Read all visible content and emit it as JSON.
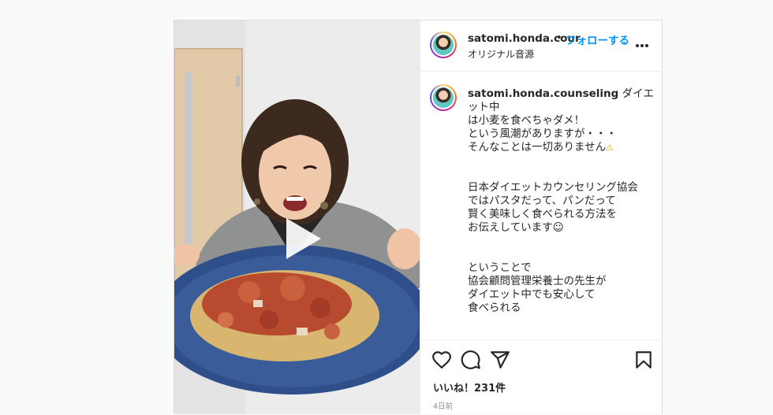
{
  "header": {
    "username": "satomi.honda.cour",
    "dot": "•",
    "follow_label": "フォローする",
    "audio_label": "オリジナル音源",
    "more_icon": "more-horizontal-icon"
  },
  "caption": {
    "username": "satomi.honda.counseling",
    "first_line": " ダイエット中",
    "lines1": [
      "は小麦を食べちゃダメ！",
      "という風潮がありますが・・・"
    ],
    "line_warn": "そんなことは一切ありません",
    "warn_icon": "⚠",
    "para2": [
      "日本ダイエットカウンセリング協会",
      "ではパスタだって、パンだって",
      "賢く美味しく食べられる方法を",
      "お伝えしています☺"
    ],
    "para3": [
      "ということで",
      "協会顧問管理栄養士の先生が",
      "ダイエット中でも安心して",
      "食べられる"
    ]
  },
  "actions": {
    "like_icon": "heart-icon",
    "comment_icon": "comment-icon",
    "share_icon": "send-icon",
    "save_icon": "bookmark-icon",
    "likes_text": "いいね！231件",
    "date_text": "4日前"
  },
  "media": {
    "play_icon": "play-icon"
  }
}
